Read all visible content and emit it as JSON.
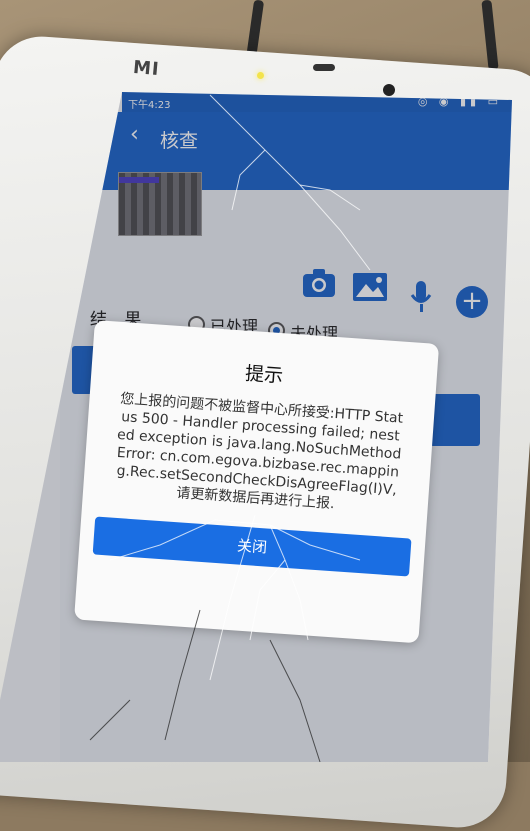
{
  "device": {
    "brand_logo": "MI"
  },
  "status_bar": {
    "time": "下午4:23",
    "icons": "◎ ◉ ▮▮ ▭"
  },
  "app_bar": {
    "back_icon": "chevron-left-icon",
    "title": "核查"
  },
  "tools": {
    "camera_icon": "camera-icon",
    "gallery_icon": "image-icon",
    "mic_icon": "microphone-icon",
    "add_icon": "plus-icon"
  },
  "form": {
    "result_label": "结 果",
    "options": [
      {
        "label": "已处理",
        "selected": false
      },
      {
        "label": "未处理",
        "selected": true
      }
    ]
  },
  "dialog": {
    "title": "提示",
    "message": "您上报的问题不被监督中心所接受:HTTP Status 500 - Handler processing failed; nested exception is java.lang.NoSuchMethodError: cn.com.egova.bizbase.rec.mapping.Rec.setSecondCheckDisAgreeFlag(I)V,请更新数据后再进行上报.",
    "close_label": "关闭"
  },
  "colors": {
    "primary": "#1b63c8",
    "dialog_button": "#1a6ee3"
  }
}
